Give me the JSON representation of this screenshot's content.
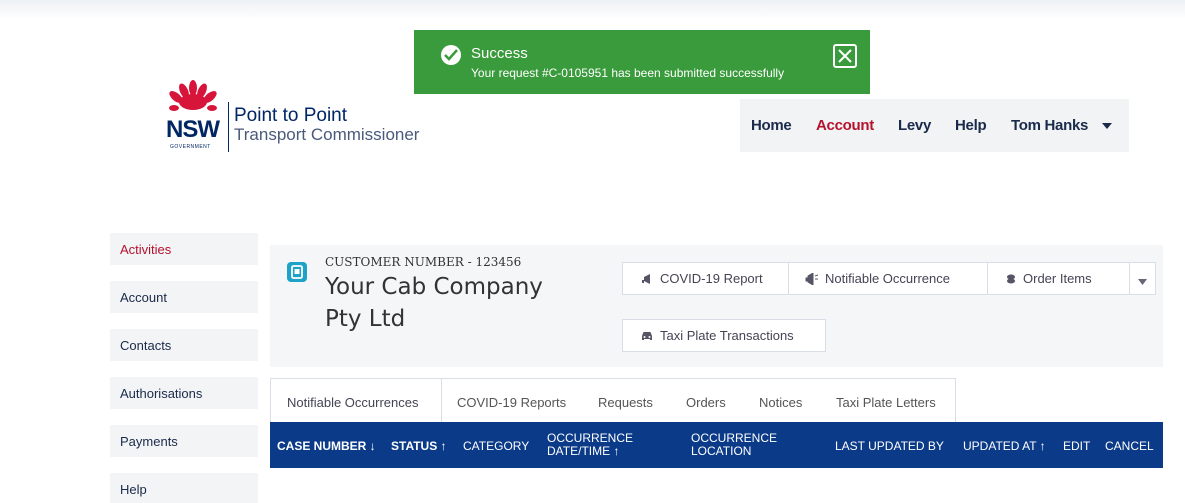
{
  "toast": {
    "title": "Success",
    "message": "Your request #C-0105951 has been submitted successfully"
  },
  "logo": {
    "nsw": "NSW",
    "government": "GOVERNMENT",
    "line1": "Point to Point",
    "line2": "Transport Commissioner"
  },
  "nav": {
    "home": "Home",
    "account": "Account",
    "levy": "Levy",
    "help": "Help",
    "user": "Tom Hanks"
  },
  "sidebar": {
    "items": [
      "Activities",
      "Account",
      "Contacts",
      "Authorisations",
      "Payments",
      "Help"
    ]
  },
  "account": {
    "customer_number": "CUSTOMER NUMBER - 123456",
    "name_line1": "Your Cab Company",
    "name_line2": "Pty Ltd"
  },
  "actions": {
    "covid": "COVID-19 Report",
    "notifiable": "Notifiable Occurrence",
    "order": "Order Items",
    "taxi": "Taxi Plate Transactions"
  },
  "tabs": [
    "Notifiable Occurrences",
    "COVID-19 Reports",
    "Requests",
    "Orders",
    "Notices",
    "Taxi Plate Letters"
  ],
  "table": {
    "columns": [
      "CASE NUMBER ↓",
      "STATUS ↑",
      "CATEGORY",
      "OCCURRENCE",
      "DATE/TIME ↑",
      "OCCURRENCE",
      "LOCATION",
      "LAST UPDATED BY",
      "UPDATED AT ↑",
      "EDIT",
      "CANCEL"
    ]
  },
  "colors": {
    "toast_green": "#3a9b3c",
    "nsw_red": "#d7153a",
    "navy": "#002664",
    "table_header": "#0b3a88",
    "active_red": "#b5122e"
  }
}
